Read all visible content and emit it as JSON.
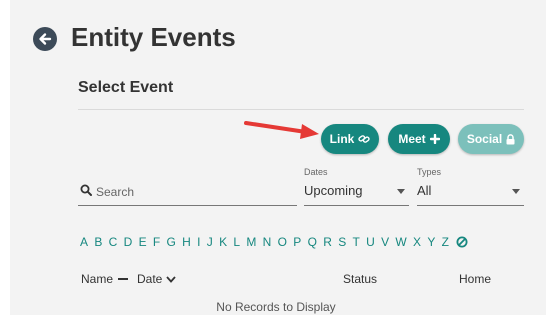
{
  "page": {
    "title": "Entity Events",
    "section_title": "Select Event"
  },
  "actions": {
    "link_label": "Link",
    "meet_label": "Meet",
    "social_label": "Social"
  },
  "filters": {
    "search_placeholder": "Search",
    "dates_label": "Dates",
    "dates_value": "Upcoming",
    "types_label": "Types",
    "types_value": "All"
  },
  "alphabet": [
    "A",
    "B",
    "C",
    "D",
    "E",
    "F",
    "G",
    "H",
    "I",
    "J",
    "K",
    "L",
    "M",
    "N",
    "O",
    "P",
    "Q",
    "R",
    "S",
    "T",
    "U",
    "V",
    "W",
    "X",
    "Y",
    "Z"
  ],
  "table": {
    "columns": {
      "name": "Name",
      "date": "Date",
      "status": "Status",
      "home": "Home"
    },
    "empty_message": "No Records to Display"
  },
  "colors": {
    "accent": "#16877f",
    "accent_disabled": "#7cc0bb",
    "annotation_arrow": "#e53935",
    "back_button": "#3c4a58"
  }
}
